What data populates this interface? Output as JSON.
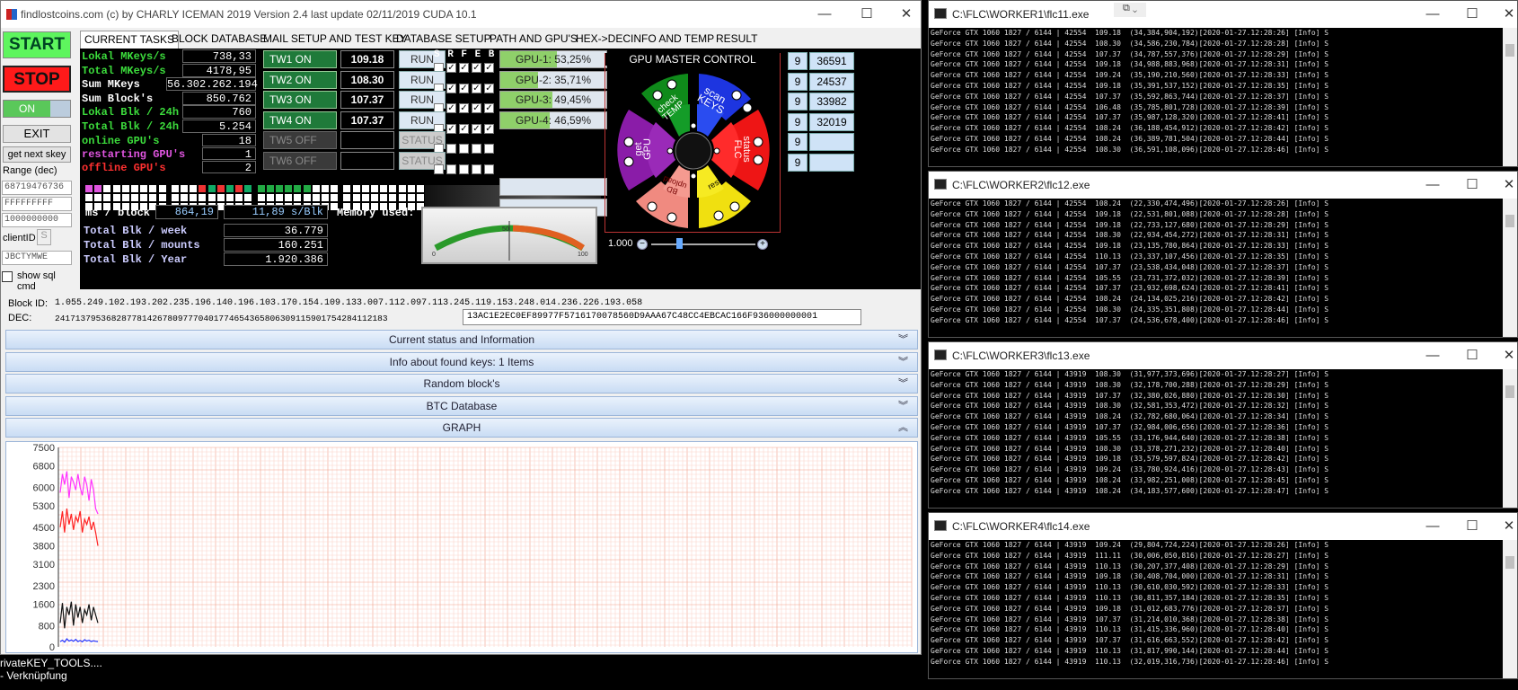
{
  "main_window": {
    "title": "findlostcoins.com (c) by CHARLY ICEMAN 2019  Version 2.4   last update  02/11/2019  CUDA 10.1"
  },
  "left": {
    "start": "START",
    "stop": "STOP",
    "toggle": "ON",
    "exit": "EXIT",
    "get_next": "get next skey",
    "range_label": "Range (dec)",
    "range_values": [
      "68719476736",
      "FFFFFFFFF",
      "1000000000"
    ],
    "client_label": "clientID",
    "client_small": "S",
    "client_id": "JBCTYMWE",
    "show_sql": "show sql cmd"
  },
  "tabs": [
    "CURRENT TASKS",
    "BLOCK DATABASE",
    "MAIL SETUP AND TEST KEY",
    "DATABASE SETUP",
    "PATH AND GPU'S",
    "HEX->DEC",
    "INFO AND TEMP",
    "RESULT"
  ],
  "stats": [
    {
      "label": "Lokal MKeys/s",
      "value": "738,33",
      "color": "#3cdc3c"
    },
    {
      "label": "Total MKeys/s",
      "value": "4178,95",
      "color": "#3cdc3c"
    },
    {
      "label": "Sum MKeys",
      "value": "56.302.262.194",
      "color": "#ffffff"
    },
    {
      "label": "Sum Block's",
      "value": "850.762",
      "color": "#ffffff"
    },
    {
      "label": "Lokal Blk / 24h",
      "value": "760",
      "color": "#3cdc3c"
    },
    {
      "label": "Total Blk / 24h",
      "value": "5.254",
      "color": "#3cdc3c"
    }
  ],
  "gpu_status": [
    {
      "label": "online GPU's",
      "value": "18",
      "color": "#3cdc3c"
    },
    {
      "label": "restarting GPU's",
      "value": "1",
      "color": "#e055e0"
    },
    {
      "label": "offline GPU's",
      "value": "2",
      "color": "#ff3030"
    }
  ],
  "workers": [
    {
      "name": "TW1 ON",
      "value": "109.18",
      "run": "RUN",
      "on": true
    },
    {
      "name": "TW2 ON",
      "value": "108.30",
      "run": "RUN",
      "on": true
    },
    {
      "name": "TW3 ON",
      "value": "107.37",
      "run": "RUN",
      "on": true
    },
    {
      "name": "TW4 ON",
      "value": "107.37",
      "run": "RUN",
      "on": true
    },
    {
      "name": "TW5 OFF",
      "value": "",
      "run": "STATUS",
      "on": false
    },
    {
      "name": "TW6 OFF",
      "value": "",
      "run": "STATUS",
      "on": false
    }
  ],
  "srfeb_header": "S R F E B",
  "gpus": [
    {
      "label": "GPU-1: 53,25%",
      "pct": 0.5325
    },
    {
      "label": "GPU-2: 35,71%",
      "pct": 0.3571
    },
    {
      "label": "GPU-3: 49,45%",
      "pct": 0.4945
    },
    {
      "label": "GPU-4: 46,59%",
      "pct": 0.4659
    }
  ],
  "master": {
    "title": "GPU MASTER CONTROL",
    "zoom": "1.000",
    "segments": [
      "check TEMP",
      "scan KEYS",
      "status FLC",
      "restart",
      "BD upload",
      "get GPU"
    ],
    "side_left": [
      "9",
      "9",
      "9",
      "9",
      "9",
      "9"
    ],
    "side_nums": [
      "36591",
      "24537",
      "33982",
      "32019",
      "",
      ""
    ]
  },
  "timing": {
    "label": "ms / block",
    "value": "864,19",
    "rate": "11,89 s/Blk",
    "memory": "Memory used:",
    "gauge_mid": "50",
    "gauge_max": "100",
    "gauge_min": "0"
  },
  "totals": [
    {
      "label": "Total Blk / week",
      "value": "36.779"
    },
    {
      "label": "Total Blk / mounts",
      "value": "160.251"
    },
    {
      "label": "Total Blk / Year",
      "value": "1.920.386"
    }
  ],
  "block": {
    "id_label": "Block ID:",
    "id_value": "1.055.249.102.193.202.235.196.140.196.103.170.154.109.133.007.112.097.113.245.119.153.248.014.236.226.193.058",
    "dec_label": "DEC:",
    "dec_value": "24171379536828778142678097770401774654365806309115901754284112183",
    "hex_value": "13AC1E2EC0EF89977F5716170078560D9AAA67C48CC4EBCAC166F936000000001"
  },
  "accordions": [
    "Current status and Information",
    "Info about found keys: 1 Items",
    "Random block's",
    "BTC Database",
    "GRAPH"
  ],
  "graph": {
    "yticks": [
      "7500",
      "6800",
      "6000",
      "5300",
      "4500",
      "3800",
      "3100",
      "2300",
      "1600",
      "800",
      "0"
    ]
  },
  "chart_data": {
    "type": "line",
    "ylim": [
      0,
      7500
    ],
    "series": [
      {
        "name": "",
        "color": "#ff33ff",
        "values": [
          5800,
          6500,
          6100,
          6600,
          5600,
          6400,
          6200,
          5900,
          6500,
          6000,
          5700,
          6400,
          6100,
          5500,
          6300,
          5900,
          5200,
          5000
        ]
      },
      {
        "name": "",
        "color": "#ff2020",
        "values": [
          4500,
          5100,
          4300,
          5200,
          4600,
          5000,
          4400,
          4900,
          4700,
          5100,
          4300,
          4800,
          4600,
          4900,
          4400,
          4700,
          4300,
          3800
        ]
      },
      {
        "name": "",
        "color": "#111111",
        "values": [
          900,
          1650,
          700,
          1500,
          1200,
          1700,
          800,
          1600,
          1100,
          1500,
          900,
          1400,
          1200,
          1600,
          1000,
          1500,
          1200,
          900
        ]
      },
      {
        "name": "",
        "color": "#2030ff",
        "values": [
          200,
          250,
          180,
          300,
          220,
          260,
          210,
          280,
          200,
          240,
          190,
          270,
          220,
          250,
          200,
          230,
          210,
          200
        ]
      }
    ]
  },
  "consoles": [
    {
      "title": "C:\\FLC\\WORKER1\\flc11.exe",
      "lines": [
        "GeForce GTX 1060 1827 / 6144 | 42554  109.18  (34,384,904,192)[2020-01-27.12:28:26] [Info] S",
        "GeForce GTX 1060 1827 / 6144 | 42554  108.30  (34,586,230,784)[2020-01-27.12:28:28] [Info] S",
        "GeForce GTX 1060 1827 / 6144 | 42554  107.37  (34,787,557,376)[2020-01-27.12:28:29] [Info] S",
        "GeForce GTX 1060 1827 / 6144 | 42554  109.18  (34,988,883,968)[2020-01-27.12:28:31] [Info] S",
        "GeForce GTX 1060 1827 / 6144 | 42554  109.24  (35,190,210,560)[2020-01-27.12:28:33] [Info] S",
        "GeForce GTX 1060 1827 / 6144 | 42554  109.18  (35,391,537,152)[2020-01-27.12:28:35] [Info] S",
        "GeForce GTX 1060 1827 / 6144 | 42554  107.37  (35,592,863,744)[2020-01-27.12:28:37] [Info] S",
        "GeForce GTX 1060 1827 / 6144 | 42554  106.48  (35,785,801,728)[2020-01-27.12:28:39] [Info] S",
        "GeForce GTX 1060 1827 / 6144 | 42554  107.37  (35,987,128,320)[2020-01-27.12:28:41] [Info] S",
        "GeForce GTX 1060 1827 / 6144 | 42554  108.24  (36,188,454,912)[2020-01-27.12:28:42] [Info] S",
        "GeForce GTX 1060 1827 / 6144 | 42554  108.24  (36,389,781,504)[2020-01-27.12:28:44] [Info] S",
        "GeForce GTX 1060 1827 / 6144 | 42554  108.30  (36,591,108,096)[2020-01-27.12:28:46] [Info] S"
      ]
    },
    {
      "title": "C:\\FLC\\WORKER2\\flc12.exe",
      "lines": [
        "GeForce GTX 1060 1827 / 6144 | 42554  108.24  (22,330,474,496)[2020-01-27.12:28:26] [Info] S",
        "GeForce GTX 1060 1827 / 6144 | 42554  109.18  (22,531,801,088)[2020-01-27.12:28:28] [Info] S",
        "GeForce GTX 1060 1827 / 6144 | 42554  109.18  (22,733,127,680)[2020-01-27.12:28:29] [Info] S",
        "GeForce GTX 1060 1827 / 6144 | 42554  108.30  (22,934,454,272)[2020-01-27.12:28:31] [Info] S",
        "GeForce GTX 1060 1827 / 6144 | 42554  109.18  (23,135,780,864)[2020-01-27.12:28:33] [Info] S",
        "GeForce GTX 1060 1827 / 6144 | 42554  110.13  (23,337,107,456)[2020-01-27.12:28:35] [Info] S",
        "GeForce GTX 1060 1827 / 6144 | 42554  107.37  (23,538,434,048)[2020-01-27.12:28:37] [Info] S",
        "GeForce GTX 1060 1827 / 6144 | 42554  105.55  (23,731,372,032)[2020-01-27.12:28:39] [Info] S",
        "GeForce GTX 1060 1827 / 6144 | 42554  107.37  (23,932,698,624)[2020-01-27.12:28:41] [Info] S",
        "GeForce GTX 1060 1827 / 6144 | 42554  108.24  (24,134,025,216)[2020-01-27.12:28:42] [Info] S",
        "GeForce GTX 1060 1827 / 6144 | 42554  108.30  (24,335,351,808)[2020-01-27.12:28:44] [Info] S",
        "GeForce GTX 1060 1827 / 6144 | 42554  107.37  (24,536,678,400)[2020-01-27.12:28:46] [Info] S"
      ]
    },
    {
      "title": "C:\\FLC\\WORKER3\\flc13.exe",
      "lines": [
        "GeForce GTX 1060 1827 / 6144 | 43919  108.30  (31,977,373,696)[2020-01-27.12:28:27] [Info] S",
        "GeForce GTX 1060 1827 / 6144 | 43919  108.30  (32,178,700,288)[2020-01-27.12:28:29] [Info] S",
        "GeForce GTX 1060 1827 / 6144 | 43919  107.37  (32,380,026,880)[2020-01-27.12:28:30] [Info] S",
        "GeForce GTX 1060 1827 / 6144 | 43919  108.30  (32,581,353,472)[2020-01-27.12:28:32] [Info] S",
        "GeForce GTX 1060 1827 / 6144 | 43919  108.24  (32,782,680,064)[2020-01-27.12:28:34] [Info] S",
        "GeForce GTX 1060 1827 / 6144 | 43919  107.37  (32,984,006,656)[2020-01-27.12:28:36] [Info] S",
        "GeForce GTX 1060 1827 / 6144 | 43919  105.55  (33,176,944,640)[2020-01-27.12:28:38] [Info] S",
        "GeForce GTX 1060 1827 / 6144 | 43919  108.30  (33,378,271,232)[2020-01-27.12:28:40] [Info] S",
        "GeForce GTX 1060 1827 / 6144 | 43919  109.18  (33,579,597,824)[2020-01-27.12:28:42] [Info] S",
        "GeForce GTX 1060 1827 / 6144 | 43919  109.24  (33,780,924,416)[2020-01-27.12:28:43] [Info] S",
        "GeForce GTX 1060 1827 / 6144 | 43919  108.24  (33,982,251,008)[2020-01-27.12:28:45] [Info] S",
        "GeForce GTX 1060 1827 / 6144 | 43919  108.24  (34,183,577,600)[2020-01-27.12:28:47] [Info] S"
      ]
    },
    {
      "title": "C:\\FLC\\WORKER4\\flc14.exe",
      "lines": [
        "GeForce GTX 1060 1827 / 6144 | 43919  109.24  (29,804,724,224)[2020-01-27.12:28:26] [Info] S",
        "GeForce GTX 1060 1827 / 6144 | 43919  111.11  (30,006,050,816)[2020-01-27.12:28:27] [Info] S",
        "GeForce GTX 1060 1827 / 6144 | 43919  110.13  (30,207,377,408)[2020-01-27.12:28:29] [Info] S",
        "GeForce GTX 1060 1827 / 6144 | 43919  109.18  (30,408,704,000)[2020-01-27.12:28:31] [Info] S",
        "GeForce GTX 1060 1827 / 6144 | 43919  110.13  (30,610,030,592)[2020-01-27.12:28:33] [Info] S",
        "GeForce GTX 1060 1827 / 6144 | 43919  110.13  (30,811,357,184)[2020-01-27.12:28:35] [Info] S",
        "GeForce GTX 1060 1827 / 6144 | 43919  109.18  (31,012,683,776)[2020-01-27.12:28:37] [Info] S",
        "GeForce GTX 1060 1827 / 6144 | 43919  107.37  (31,214,010,368)[2020-01-27.12:28:38] [Info] S",
        "GeForce GTX 1060 1827 / 6144 | 43919  110.13  (31,415,336,960)[2020-01-27.12:28:40] [Info] S",
        "GeForce GTX 1060 1827 / 6144 | 43919  107.37  (31,616,663,552)[2020-01-27.12:28:42] [Info] S",
        "GeForce GTX 1060 1827 / 6144 | 43919  110.13  (31,817,990,144)[2020-01-27.12:28:44] [Info] S",
        "GeForce GTX 1060 1827 / 6144 | 43919  110.13  (32,019,316,736)[2020-01-27.12:28:46] [Info] S"
      ]
    }
  ],
  "desktop_icon": {
    "line1": "rivateKEY_TOOLS....",
    "line2": " - Verknüpfung"
  }
}
